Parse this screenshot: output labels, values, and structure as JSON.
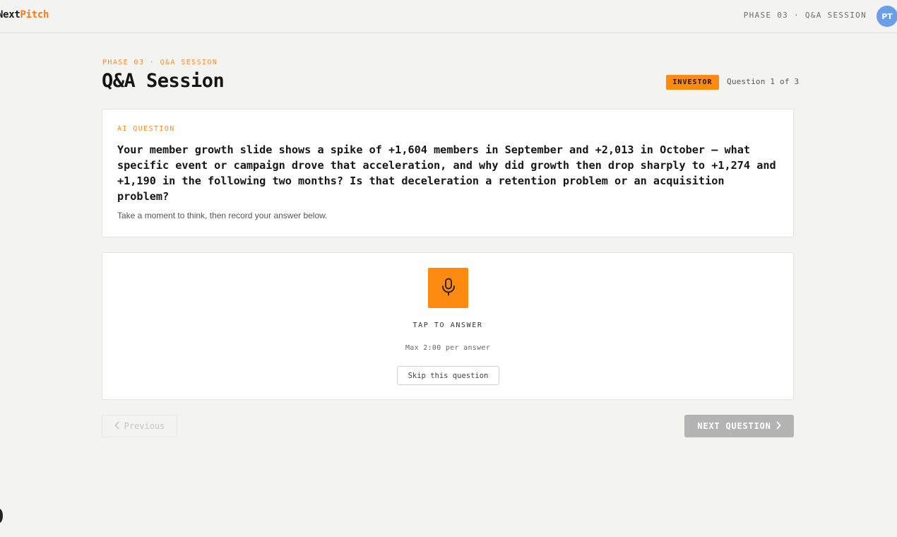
{
  "app": {
    "brand_part1": "Next",
    "brand_part2": "Pitch",
    "phase_label": "PHASE 03 · Q&A SESSION",
    "avatar_initials": "PT"
  },
  "header": {
    "eyebrow": "PHASE 03 · Q&A SESSION",
    "title": "Q&A Session",
    "role_badge": "INVESTOR",
    "question_counter": "Question 1 of 3"
  },
  "question": {
    "label": "AI QUESTION",
    "text": "Your member growth slide shows a spike of +1,604 members in September and +2,013 in October — what specific event or campaign drove that acceleration, and why did growth then drop sharply to +1,274 and +1,190 in the following two months? Is that deceleration a retention problem or an acquisition problem?",
    "hint": "Take a moment to think, then record your answer below."
  },
  "answer": {
    "mic_icon": "microphone-icon",
    "tap_label": "TAP TO ANSWER",
    "max_label": "Max 2:00 per answer",
    "skip_label": "Skip this question"
  },
  "nav": {
    "previous_label": "Previous",
    "next_label": "NEXT QUESTION"
  },
  "colors": {
    "accent": "#ff8a12",
    "avatar": "#6b9de8",
    "disabled_button": "#b3b3b3"
  }
}
